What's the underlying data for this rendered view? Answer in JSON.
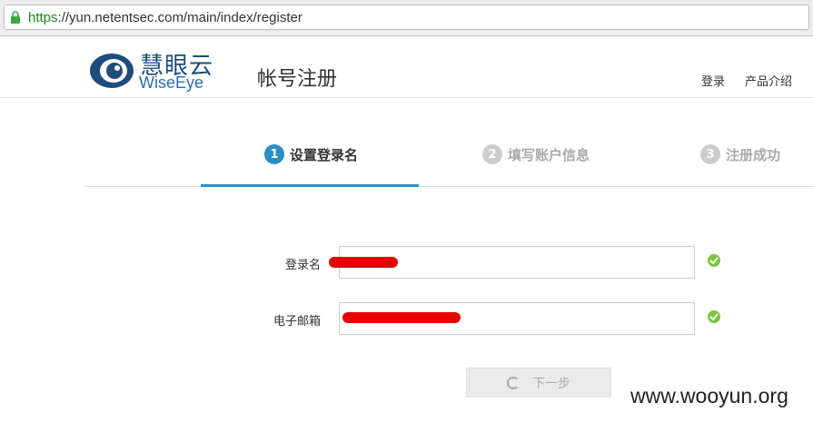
{
  "browser": {
    "url_protocol": "https",
    "url_rest": "://yun.netentsec.com/main/index/register"
  },
  "header": {
    "logo_cn": "慧眼云",
    "logo_en": "WiseEye",
    "page_title": "帐号注册",
    "nav_login": "登录",
    "nav_product": "产品介绍"
  },
  "steps": [
    {
      "num": "1",
      "label": "设置登录名",
      "active": true
    },
    {
      "num": "2",
      "label": "填写账户信息",
      "active": false
    },
    {
      "num": "3",
      "label": "注册成功",
      "active": false
    }
  ],
  "form": {
    "username_label": "登录名",
    "email_label": "电子邮箱",
    "next_label": "下一步"
  },
  "watermark": "www.wooyun.org",
  "colors": {
    "accent": "#2a8fc2",
    "valid": "#7fc241",
    "redaction": "#e60000"
  }
}
